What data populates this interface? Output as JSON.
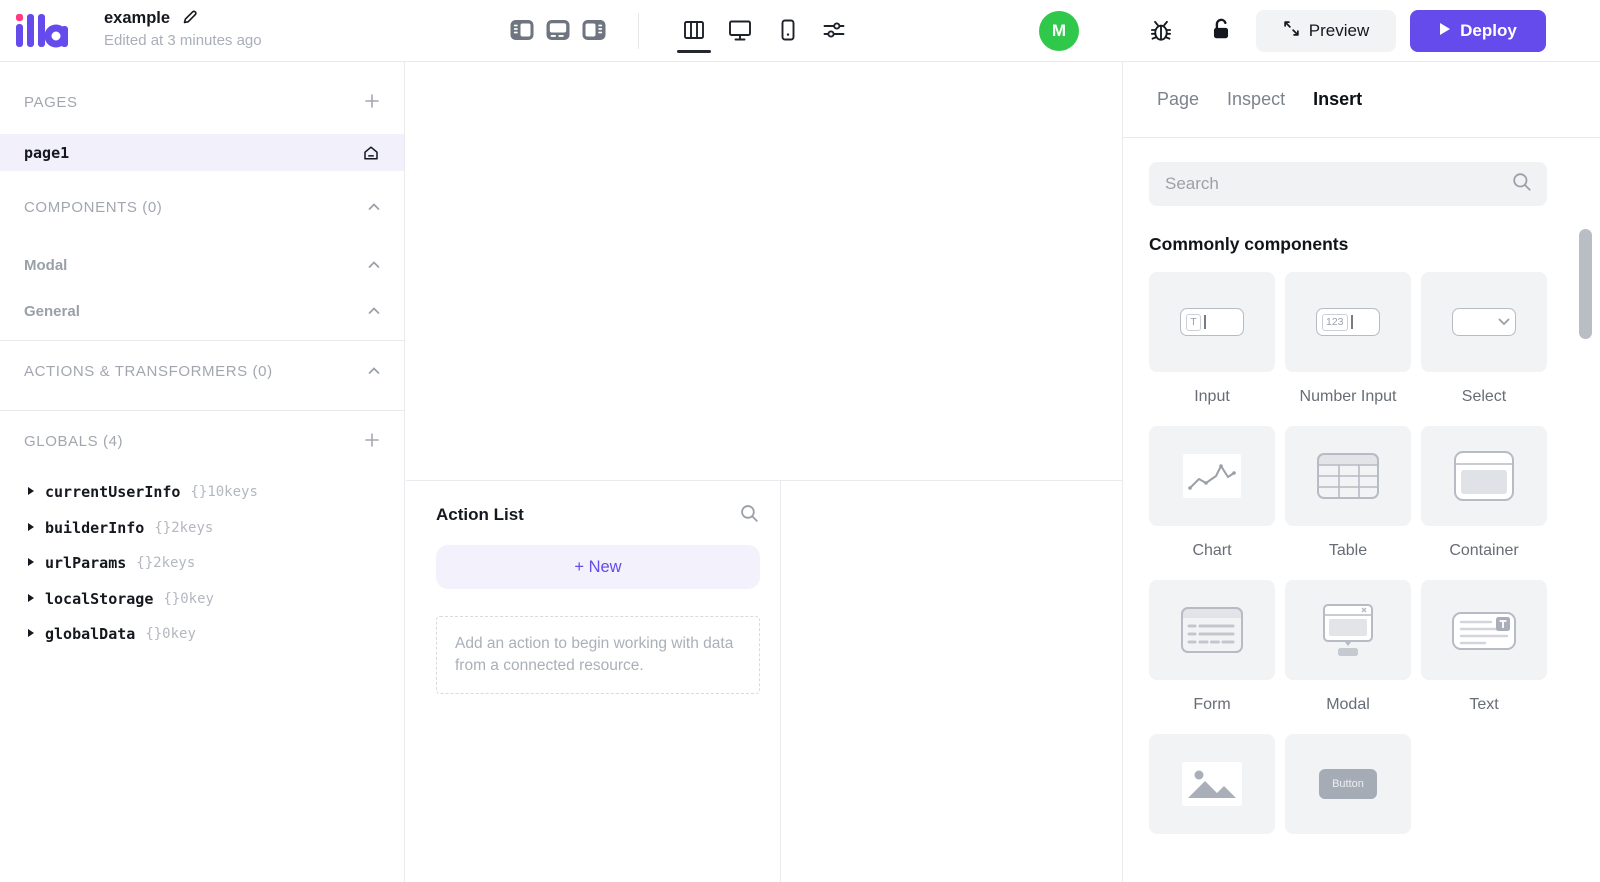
{
  "topbar": {
    "logo_text": "illa",
    "app_name": "example",
    "edited_status": "Edited at 3 minutes ago",
    "avatar_initial": "M",
    "preview_label": "Preview",
    "deploy_label": "Deploy"
  },
  "left_sidebar": {
    "pages_header": "PAGES",
    "pages": [
      {
        "name": "page1"
      }
    ],
    "components_header": "COMPONENTS (0)",
    "component_groups": [
      {
        "label": "Modal"
      },
      {
        "label": "General"
      }
    ],
    "actions_header": "ACTIONS & TRANSFORMERS (0)",
    "globals_header": "GLOBALS (4)",
    "globals": {
      "items": [
        {
          "name": "currentUserInfo",
          "meta": "{}10keys"
        },
        {
          "name": "builderInfo",
          "meta": "{}2keys"
        },
        {
          "name": "urlParams",
          "meta": "{}2keys"
        },
        {
          "name": "localStorage",
          "meta": "{}0key"
        },
        {
          "name": "globalData",
          "meta": "{}0key"
        }
      ]
    }
  },
  "action_panel": {
    "title": "Action List",
    "new_button": "+ New",
    "empty_hint": "Add an action to begin working with data from a connected resource."
  },
  "right_panel": {
    "tabs": [
      {
        "label": "Page",
        "active": false
      },
      {
        "label": "Inspect",
        "active": false
      },
      {
        "label": "Insert",
        "active": true
      }
    ],
    "search_placeholder": "Search",
    "section_title": "Commonly components",
    "input_glyph_text": "T",
    "number_glyph_text": "123",
    "button_card_text": "Button",
    "components": [
      {
        "icon": "input-icon",
        "label": "Input"
      },
      {
        "icon": "number-input-icon",
        "label": "Number Input"
      },
      {
        "icon": "select-icon",
        "label": "Select"
      },
      {
        "icon": "chart-icon",
        "label": "Chart"
      },
      {
        "icon": "table-icon",
        "label": "Table"
      },
      {
        "icon": "container-icon",
        "label": "Container"
      },
      {
        "icon": "form-icon",
        "label": "Form"
      },
      {
        "icon": "modal-icon",
        "label": "Modal"
      },
      {
        "icon": "text-icon",
        "label": "Text"
      },
      {
        "icon": "image-icon",
        "label": ""
      },
      {
        "icon": "button-icon",
        "label": ""
      }
    ]
  },
  "colors": {
    "brand_purple": "#654aec",
    "avatar_green": "#2fc84a",
    "logo_pink": "#ff3b82",
    "page_row_highlight": "#f2f1fb",
    "card_background": "#f1f3f5"
  },
  "icons": {
    "toolbar": [
      "panel-left-icon",
      "panel-bottom-icon",
      "panel-right-icon",
      "columns-layout-icon",
      "monitor-icon",
      "tablet-icon",
      "sliders-icon"
    ],
    "topbar_right": [
      "bug-icon",
      "unlock-icon",
      "expand-icon",
      "play-icon"
    ],
    "misc": [
      "pencil-icon",
      "home-icon",
      "plus-icon",
      "chevron-up-icon",
      "caret-right-icon",
      "search-icon"
    ]
  }
}
